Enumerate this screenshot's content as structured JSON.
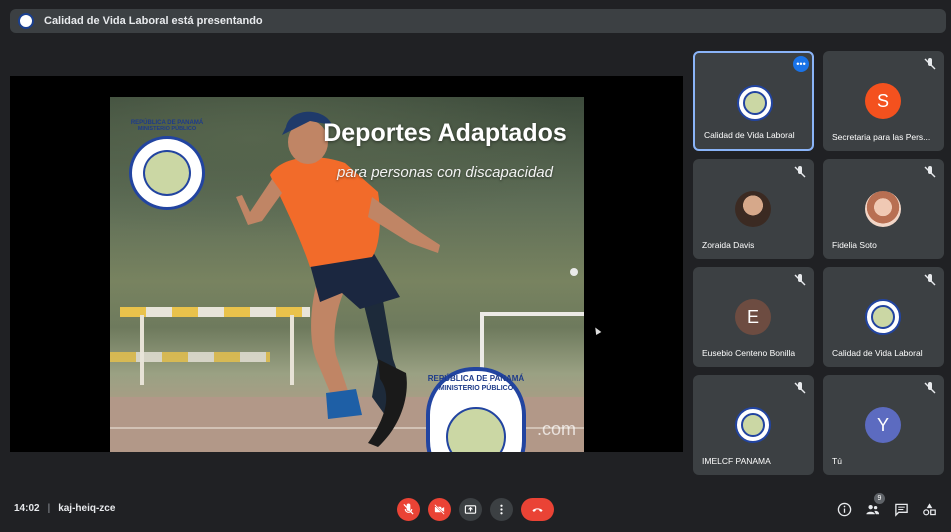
{
  "banner": {
    "text": "Calidad de Vida Laboral está presentando"
  },
  "slide": {
    "title": "Deportes Adaptados",
    "subtitle": "para personas con discapacidad",
    "watermark_suffix": ".com",
    "emblem_top": "REPÚBLICA DE PANAMÁ",
    "emblem_sub": "MINISTERIO PÚBLICO",
    "emblem_ring": "INSTITUTO DE MEDICINA LEGAL Y CIENCIAS FORENSES"
  },
  "participants": [
    {
      "name": "Calidad de Vida Laboral",
      "avatar": "logo",
      "muted": false,
      "active": true,
      "menu": "•••"
    },
    {
      "name": "Secretaria para las Pers...",
      "avatar": "letter",
      "letter": "S",
      "color": "#f4511e",
      "muted": true
    },
    {
      "name": "Zoraida Davis",
      "avatar": "photo",
      "muted": true
    },
    {
      "name": "Fidelia Soto",
      "avatar": "photo",
      "muted": true
    },
    {
      "name": "Eusebio Centeno Bonilla",
      "avatar": "letter",
      "letter": "E",
      "color": "#6d4c41",
      "muted": true
    },
    {
      "name": "Calidad de Vida Laboral",
      "avatar": "logo",
      "muted": true
    },
    {
      "name": "IMELCF PANAMA",
      "avatar": "logo",
      "muted": true
    },
    {
      "name": "Tú",
      "avatar": "letter",
      "letter": "Y",
      "color": "#5c6bc0",
      "muted": true
    }
  ],
  "bottom": {
    "time": "14:02",
    "separator": "|",
    "meeting_code": "kaj-heiq-zce",
    "people_count": "9"
  },
  "icons": [
    "mic-off-icon",
    "camera-off-icon",
    "present-icon",
    "more-vert-icon",
    "hang-up-icon",
    "info-icon",
    "people-icon",
    "chat-icon",
    "activities-icon"
  ],
  "colors": {
    "background": "#202124",
    "tile": "#3c4043",
    "danger": "#ea4335",
    "accent": "#8ab4f8"
  }
}
